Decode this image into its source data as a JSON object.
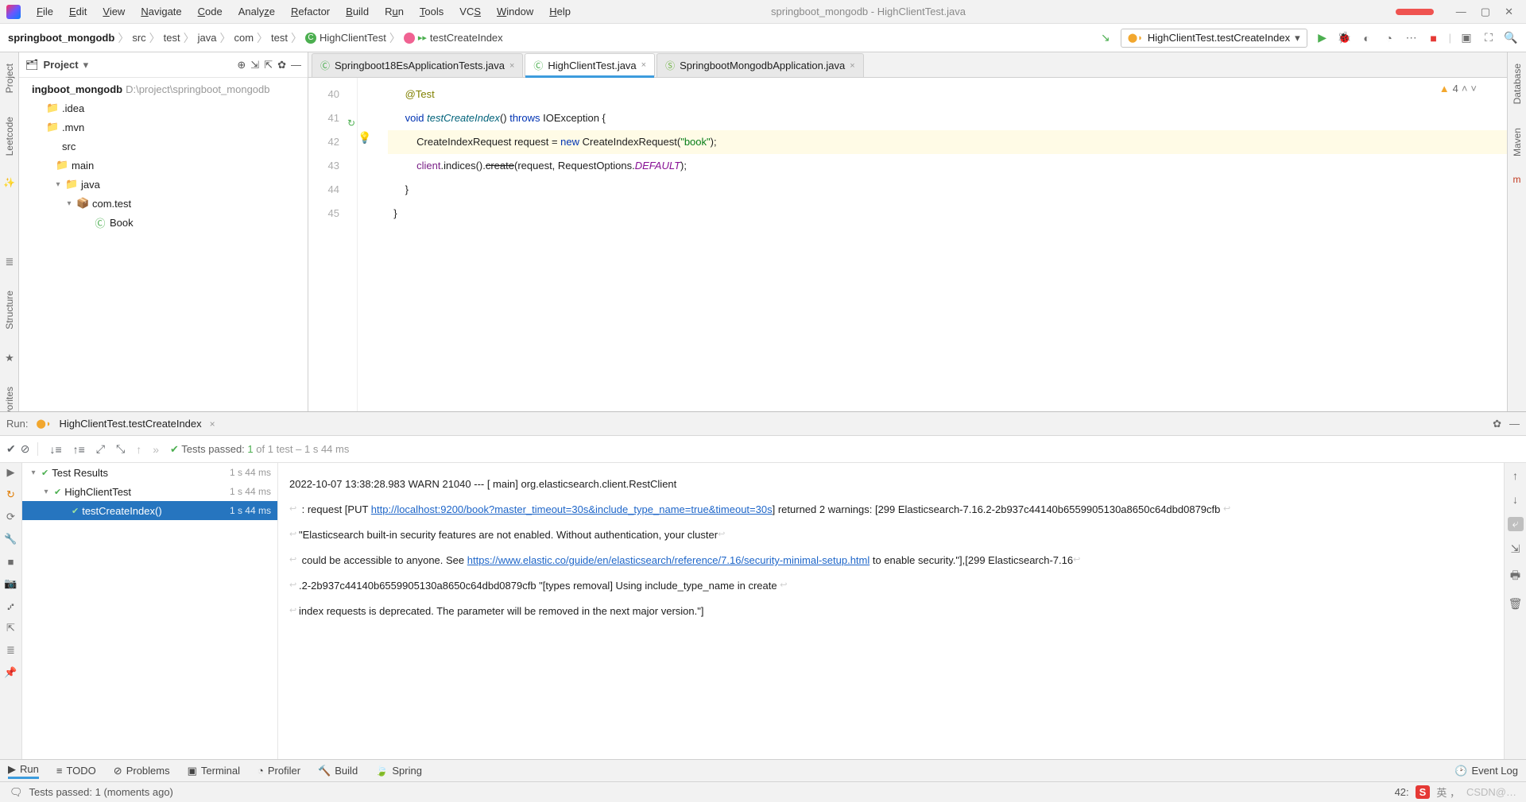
{
  "window": {
    "title": "springboot_mongodb - HighClientTest.java"
  },
  "menu": [
    "File",
    "Edit",
    "View",
    "Navigate",
    "Code",
    "Analyze",
    "Refactor",
    "Build",
    "Run",
    "Tools",
    "VCS",
    "Window",
    "Help"
  ],
  "breadcrumbs": [
    "springboot_mongodb",
    "src",
    "test",
    "java",
    "com",
    "test",
    "HighClientTest",
    "testCreateIndex"
  ],
  "run_config": "HighClientTest.testCreateIndex",
  "project": {
    "tool": "Project",
    "root": {
      "name": "ingboot_mongodb",
      "path": "D:\\project\\springboot_mongodb"
    },
    "nodes": [
      {
        "pad": 16,
        "arrow": "",
        "icon": "📁",
        "name": ".idea"
      },
      {
        "pad": 16,
        "arrow": "",
        "icon": "📁",
        "name": ".mvn"
      },
      {
        "pad": 16,
        "arrow": "",
        "icon": "",
        "name": "src"
      },
      {
        "pad": 28,
        "arrow": "",
        "icon": "📁",
        "name": "main"
      },
      {
        "pad": 40,
        "arrow": "▾",
        "icon": "📁",
        "name": "java",
        "blue": true
      },
      {
        "pad": 54,
        "arrow": "▾",
        "icon": "📦",
        "name": "com.test"
      },
      {
        "pad": 76,
        "arrow": "",
        "icon": "Ⓒ",
        "name": "Book"
      }
    ]
  },
  "tabs": [
    {
      "name": "Springboot18EsApplicationTests.java",
      "active": false,
      "icon": "Ⓒ"
    },
    {
      "name": "HighClientTest.java",
      "active": true,
      "icon": "Ⓒ"
    },
    {
      "name": "SpringbootMongodbApplication.java",
      "active": false,
      "icon": "Ⓢ"
    }
  ],
  "warnings": "4",
  "code": {
    "lines": [
      {
        "n": 40,
        "html": "      <span class='ann'>@Test</span>"
      },
      {
        "n": 41,
        "gicn": "↻",
        "html": "      <span class='kw'>void</span> <span class='mth'>testCreateIndex</span>() <span class='kw'>throws</span> IOException {"
      },
      {
        "n": 42,
        "hl": true,
        "bulb": true,
        "html": "          CreateIndexRequest request = <span class='kw'>new</span> CreateIndexRequest(<span class='str'>\"book\"</span>);"
      },
      {
        "n": 43,
        "html": "          <span class='fld'>client</span>.indices().<span class='strike'>create</span>(request, RequestOptions.<span class='def'>DEFAULT</span>);"
      },
      {
        "n": 44,
        "html": "      }"
      },
      {
        "n": 45,
        "html": "  }"
      }
    ]
  },
  "run": {
    "title": "Run:",
    "config": "HighClientTest.testCreateIndex",
    "passed_label": "Tests passed:",
    "passed_count": "1",
    "passed_total": "of 1 test",
    "duration": "– 1 s 44 ms",
    "tree": [
      {
        "pad": 4,
        "arrow": "▾",
        "chk": true,
        "name": "Test Results",
        "time": "1 s 44 ms"
      },
      {
        "pad": 20,
        "arrow": "▾",
        "chk": true,
        "name": "HighClientTest",
        "time": "1 s 44 ms"
      },
      {
        "pad": 42,
        "arrow": "",
        "chk": true,
        "name": "testCreateIndex()",
        "time": "1 s 44 ms",
        "sel": true
      }
    ],
    "console": {
      "line1": "2022-10-07 13:38:28.983  WARN 21040 --- [           main]  org.elasticsearch.client.RestClient ",
      "line2_a": "   : request [PUT ",
      "line2_link": "http://localhost:9200/book?master_timeout=30s&include_type_name=true&timeout=30s",
      "line2_b": "] returned 2 warnings: [299 Elasticsearch-7.16.2-2b937c44140b6559905130a8650c64dbd0879cfb ",
      "line3": "\"Elasticsearch built-in security features are not enabled. Without authentication, your cluster",
      "line4_a": " could be accessible to anyone. See ",
      "line4_link": "https://www.elastic.co/guide/en/elasticsearch/reference/7.16/security-minimal-setup.html",
      "line4_b": " to enable security.\"],[299 Elasticsearch-7.16",
      "line5": ".2-2b937c44140b6559905130a8650c64dbd0879cfb \"[types removal] Using include_type_name in create ",
      "line6": "index requests is deprecated. The parameter will be removed in the next major version.\"]"
    }
  },
  "bottom_buttons": [
    {
      "icon": "▶",
      "label": "Run",
      "active": true
    },
    {
      "icon": "≡",
      "label": "TODO"
    },
    {
      "icon": "⊘",
      "label": "Problems"
    },
    {
      "icon": "▣",
      "label": "Terminal"
    },
    {
      "icon": "◔",
      "label": "Profiler"
    },
    {
      "icon": "🔨",
      "label": "Build"
    },
    {
      "icon": "🍃",
      "label": "Spring"
    }
  ],
  "event_log": "Event Log",
  "status": {
    "msg": "Tests passed: 1 (moments ago)",
    "pos": "42:"
  },
  "side_labels": {
    "proj": "Project",
    "leet": "Leetcode",
    "struct": "Structure",
    "fav": "Favorites",
    "db": "Database",
    "mvn": "Maven"
  }
}
